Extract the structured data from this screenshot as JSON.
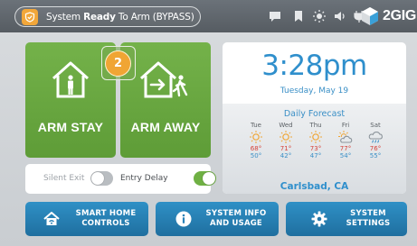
{
  "status": {
    "prefix": "System",
    "state": "Ready",
    "suffix": "To Arm (BYPASS)"
  },
  "logo": {
    "text": "2GIG"
  },
  "top_icons": [
    "chat-bubble-icon",
    "bookmark-icon",
    "brightness-icon",
    "volume-icon",
    "settings-plug-icon"
  ],
  "arm": {
    "stay_label": "ARM STAY",
    "away_label": "ARM AWAY",
    "badge_count": "2"
  },
  "toggles": {
    "silent_exit_label": "Silent Exit",
    "silent_exit_on": false,
    "entry_delay_label": "Entry Delay",
    "entry_delay_on": true
  },
  "clock": {
    "time": "3:28pm",
    "date": "Tuesday, May 19"
  },
  "forecast": {
    "title": "Daily Forecast",
    "days": [
      {
        "name": "Tue",
        "high": "68°",
        "low": "50°",
        "icon": "sun-icon"
      },
      {
        "name": "Wed",
        "high": "71°",
        "low": "42°",
        "icon": "sun-icon"
      },
      {
        "name": "Thu",
        "high": "73°",
        "low": "47°",
        "icon": "sun-icon"
      },
      {
        "name": "Fri",
        "high": "77°",
        "low": "54°",
        "icon": "partly-cloudy-icon"
      },
      {
        "name": "Sat",
        "high": "76°",
        "low": "55°",
        "icon": "rain-cloud-icon"
      }
    ],
    "location": "Carlsbad, CA"
  },
  "buttons": {
    "smart_home": {
      "line1": "SMART HOME",
      "line2": "CONTROLS"
    },
    "system_info": {
      "line1": "SYSTEM INFO",
      "line2": "AND USAGE"
    },
    "system_settings": {
      "line1": "SYSTEM",
      "line2": "SETTINGS"
    }
  },
  "colors": {
    "arm_green": "#6aa842",
    "accent_blue": "#2f8fcc",
    "badge_orange": "#f0a534",
    "high_temp": "#d6423a"
  }
}
